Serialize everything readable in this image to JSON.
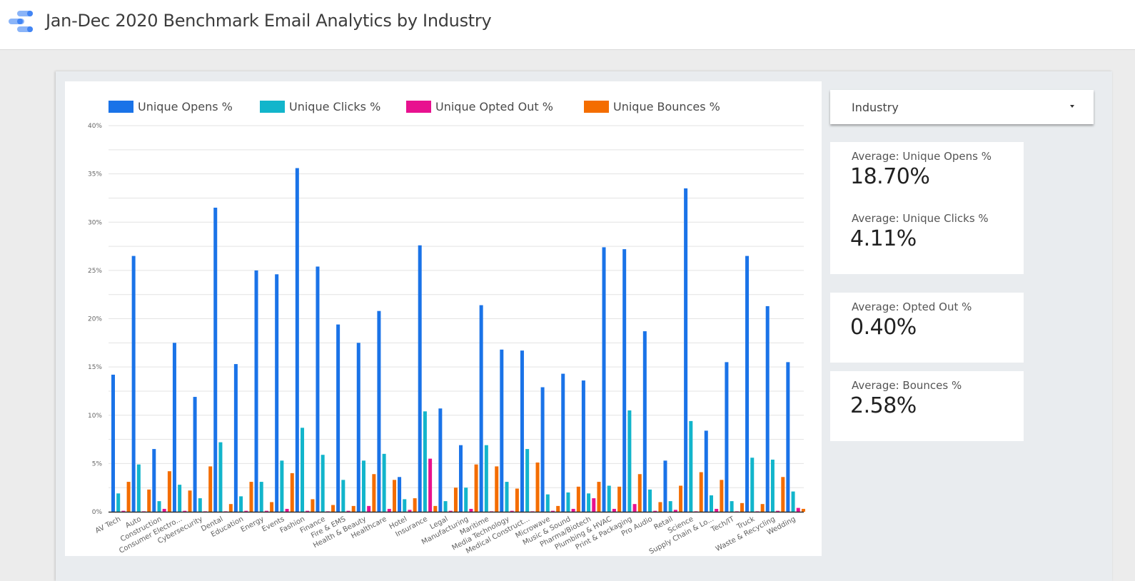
{
  "header": {
    "title": "Jan-Dec 2020 Benchmark Email Analytics by Industry",
    "logo_icon": "looker-studio-logo-icon"
  },
  "filter": {
    "label": "Industry",
    "icon": "caret-down-icon"
  },
  "scorecards": [
    {
      "label": "Average: Unique Opens %",
      "value": "18.70%"
    },
    {
      "label": "Average: Unique Clicks %",
      "value": "4.11%"
    },
    {
      "label": "Average: Opted Out %",
      "value": "0.40%"
    },
    {
      "label": "Average: Bounces %",
      "value": "2.58%"
    }
  ],
  "chart_data": {
    "type": "bar",
    "title": "",
    "xlabel": "",
    "ylabel": "",
    "ylim": [
      0,
      40
    ],
    "yticks": [
      "0%",
      "5%",
      "10%",
      "15%",
      "20%",
      "25%",
      "30%",
      "35%",
      "40%"
    ],
    "grid": true,
    "legend_position": "top-left",
    "categories": [
      "AV Tech",
      "Auto",
      "Construction",
      "Consumer Electro...",
      "Cybersecurity",
      "Dental",
      "Education",
      "Energy",
      "Events",
      "Fashion",
      "Finance",
      "Fire & EMS",
      "Health & Beauty",
      "Healthcare",
      "Hotel",
      "Insurance",
      "Legal",
      "Manufacturing",
      "Maritime",
      "Media Technology",
      "Medical Construct...",
      "Microwave",
      "Music & Sound",
      "Pharma/Biotech",
      "Plumbing & HVAC",
      "Print & Packaging",
      "Pro Audio",
      "Retail",
      "Science",
      "Supply Chain & Lo...",
      "Tech/IT",
      "Truck",
      "Waste & Recycling",
      "Wedding"
    ],
    "series": [
      {
        "name": "Unique Opens %",
        "color": "#1a73e8",
        "values": [
          14.2,
          26.5,
          6.5,
          17.5,
          11.9,
          31.5,
          15.3,
          25.0,
          24.6,
          35.6,
          25.4,
          19.4,
          17.5,
          20.8,
          3.6,
          27.6,
          10.7,
          6.9,
          21.4,
          16.8,
          16.7,
          12.9,
          14.3,
          13.6,
          27.4,
          27.2,
          18.7,
          5.3,
          33.5,
          8.4,
          15.5,
          26.5,
          21.3,
          15.5
        ]
      },
      {
        "name": "Unique Clicks %",
        "color": "#12b5cb",
        "values": [
          1.9,
          4.9,
          1.1,
          2.8,
          1.4,
          7.2,
          1.6,
          3.1,
          5.3,
          8.7,
          5.9,
          3.3,
          5.3,
          6.0,
          1.3,
          10.4,
          1.1,
          2.5,
          6.9,
          3.1,
          6.5,
          1.8,
          2.0,
          1.9,
          2.7,
          10.5,
          2.3,
          1.1,
          9.4,
          1.7,
          1.1,
          5.6,
          5.4,
          2.1
        ]
      },
      {
        "name": "Unique Opted Out %",
        "color": "#e8118f",
        "values": [
          0.1,
          0.05,
          0.3,
          0.1,
          0.05,
          0.05,
          0.1,
          0.1,
          0.3,
          0.1,
          0.05,
          0.1,
          0.6,
          0.3,
          0.2,
          5.5,
          0.1,
          0.3,
          0.05,
          0.1,
          0.05,
          0.1,
          0.3,
          1.4,
          0.3,
          0.8,
          0.1,
          0.2,
          0.05,
          0.3,
          0.05,
          0.05,
          0.1,
          0.4
        ]
      },
      {
        "name": "Unique Bounces %",
        "color": "#f46d00",
        "values": [
          3.1,
          2.3,
          4.2,
          2.2,
          4.7,
          0.8,
          3.1,
          1.0,
          4.0,
          1.3,
          0.7,
          0.6,
          3.9,
          3.3,
          1.4,
          0.6,
          2.5,
          4.9,
          4.7,
          2.4,
          5.1,
          0.6,
          2.6,
          3.1,
          2.6,
          3.9,
          1.0,
          2.7,
          4.1,
          3.3,
          0.9,
          0.8,
          3.6,
          0.3
        ]
      }
    ]
  }
}
